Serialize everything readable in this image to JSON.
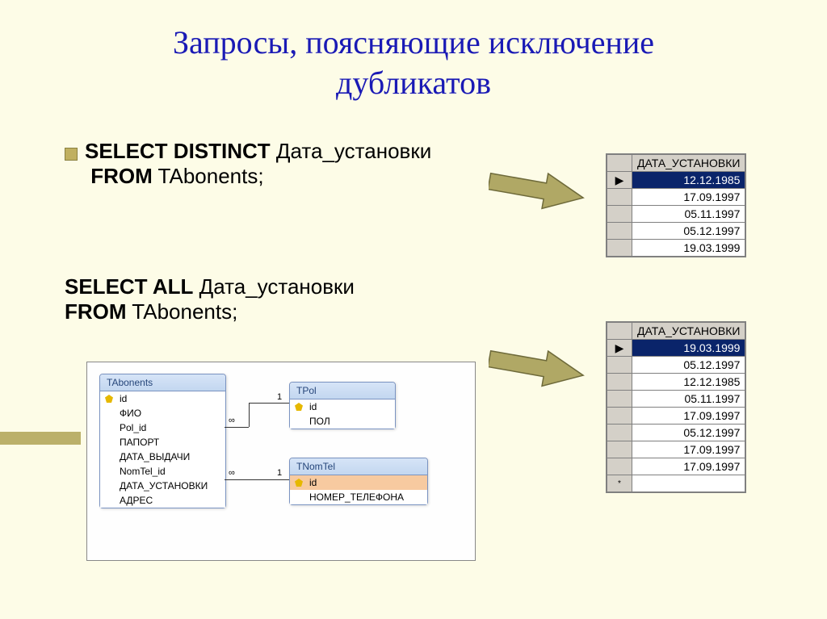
{
  "title_line1": "Запросы, поясняющие исключение",
  "title_line2": "дубликатов",
  "query1": {
    "select": "SELECT DISTINCT",
    "col": " Дата_установки",
    "from": "FROM",
    "table": " TAbonents;"
  },
  "query2": {
    "select": "SELECT ALL",
    "col": " Дата_установки",
    "from": "FROM",
    "table": " TAbonents;"
  },
  "grid_header": "ДАТА_УСТАНОВКИ",
  "grid1_rows": [
    "12.12.1985",
    "17.09.1997",
    "05.11.1997",
    "05.12.1997",
    "19.03.1999"
  ],
  "grid2_rows": [
    "19.03.1999",
    "05.12.1997",
    "12.12.1985",
    "05.11.1997",
    "17.09.1997",
    "05.12.1997",
    "17.09.1997",
    "17.09.1997"
  ],
  "diag": {
    "t1": {
      "title": "TAbonents",
      "fields": [
        "id",
        "ФИО",
        "Pol_id",
        "ПАПОРТ",
        "ДАТА_ВЫДАЧИ",
        "NomTel_id",
        "ДАТА_УСТАНОВКИ",
        "АДРЕС"
      ]
    },
    "t2": {
      "title": "TPol",
      "fields": [
        "id",
        "ПОЛ"
      ]
    },
    "t3": {
      "title": "TNomTel",
      "fields": [
        "id",
        "НОМЕР_ТЕЛЕФОНА"
      ]
    }
  },
  "rel_inf": "∞",
  "rel_one": "1"
}
